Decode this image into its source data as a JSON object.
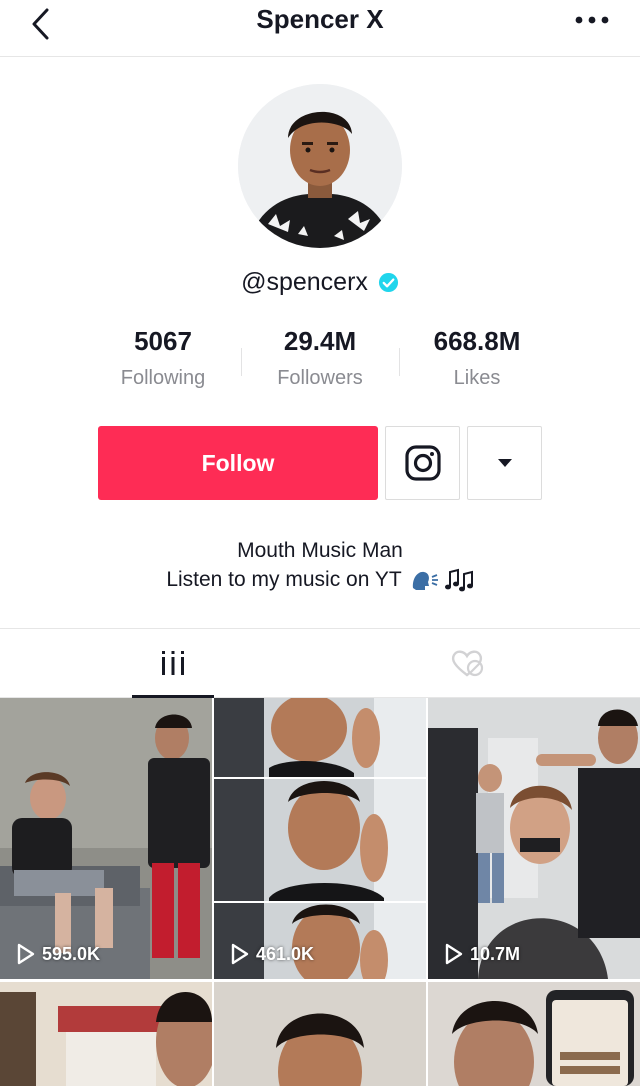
{
  "header": {
    "title": "Spencer X"
  },
  "profile": {
    "username": "@spencerx",
    "verified": true
  },
  "stats": [
    {
      "value": "5067",
      "label": "Following"
    },
    {
      "value": "29.4M",
      "label": "Followers"
    },
    {
      "value": "668.8M",
      "label": "Likes"
    }
  ],
  "actions": {
    "follow_label": "Follow"
  },
  "bio": {
    "line1": "Mouth Music Man",
    "line2": "Listen to my music on YT"
  },
  "tabs": [
    {
      "name": "videos",
      "active": true
    },
    {
      "name": "liked",
      "active": false
    }
  ],
  "videos": [
    {
      "views": "595.0K"
    },
    {
      "views": "461.0K"
    },
    {
      "views": "10.7M"
    },
    {
      "views": ""
    },
    {
      "views": ""
    },
    {
      "views": ""
    }
  ],
  "colors": {
    "accent": "#fe2c55",
    "verified": "#20d5ec",
    "text": "#161823",
    "muted": "#8a8b91"
  }
}
